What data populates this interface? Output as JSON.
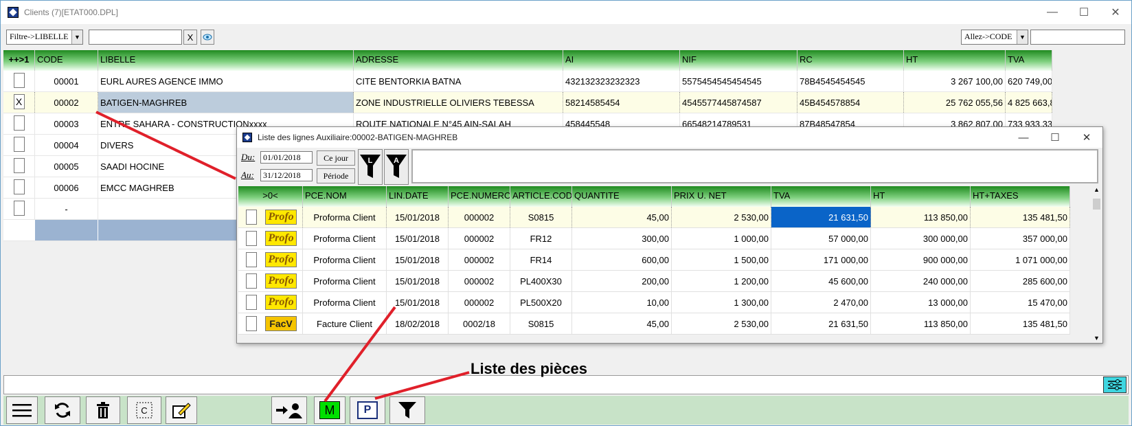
{
  "window": {
    "title": "Clients (7)[ETAT000.DPL]",
    "minimize": "—",
    "maximize": "☐",
    "close": "✕"
  },
  "filterbar": {
    "filter_select": "Filtre->LIBELLE",
    "filter_value": "",
    "clear_label": "X",
    "goto_select": "Allez->CODE",
    "goto_value": ""
  },
  "clients_grid": {
    "headers": [
      "++>1",
      "CODE",
      "LIBELLE",
      "ADRESSE",
      "AI",
      "NIF",
      "RC",
      "HT",
      "TVA"
    ],
    "rows": [
      {
        "check": "",
        "code": "00001",
        "libelle": "EURL AURES AGENCE IMMO",
        "adresse": "CITE BENTORKIA BATNA",
        "ai": "432132323232323",
        "nif": "5575454545454545",
        "rc": "78B4545454545",
        "ht": "3 267 100,00",
        "tva": "620 749,00"
      },
      {
        "check": "X",
        "code": "00002",
        "libelle": "BATIGEN-MAGHREB",
        "adresse": "ZONE INDUSTRIELLE OLIVIERS TEBESSA",
        "ai": "58214585454",
        "nif": "4545577445874587",
        "rc": "45B454578854",
        "ht": "25 762 055,56",
        "tva": "4 825 663,8"
      },
      {
        "check": "",
        "code": "00003",
        "libelle": "ENTRE SAHARA - CONSTRUCTIONxxxx",
        "adresse": "ROUTE NATIONALE N°45 AIN-SALAH",
        "ai": "458445548",
        "nif": "66548214789531",
        "rc": "87B48547854",
        "ht": "3 862 807,00",
        "tva": "733 933,33"
      },
      {
        "check": "",
        "code": "00004",
        "libelle": "DIVERS",
        "adresse": "",
        "ai": "",
        "nif": "",
        "rc": "",
        "ht": "",
        "tva": ""
      },
      {
        "check": "",
        "code": "00005",
        "libelle": "SAADI HOCINE",
        "adresse": "",
        "ai": "",
        "nif": "",
        "rc": "",
        "ht": "",
        "tva": ""
      },
      {
        "check": "",
        "code": "00006",
        "libelle": "EMCC MAGHREB",
        "adresse": "",
        "ai": "",
        "nif": "",
        "rc": "",
        "ht": "",
        "tva": ""
      },
      {
        "check": "",
        "code": "-",
        "libelle": "",
        "adresse": "",
        "ai": "",
        "nif": "",
        "rc": "",
        "ht": "",
        "tva": ""
      }
    ]
  },
  "popup": {
    "title": "Liste des lignes Auxiliaire:00002-BATIGEN-MAGHREB",
    "du_label": "Du:",
    "du_value": "01/01/2018",
    "au_label": "Au:",
    "au_value": "31/12/2018",
    "ce_jour": "Ce jour",
    "periode": "Période",
    "filter_l": "L",
    "filter_a": "A",
    "headers": [
      ">0<",
      "PCE.NOM",
      "LIN.DATE",
      "PCE.NUMERO",
      "ARTICLE.CODE",
      "QUANTITE",
      "PRIX U. NET",
      "TVA",
      "HT",
      "HT+TAXES"
    ],
    "rows": [
      {
        "badge": "Profo",
        "nom": "Proforma Client",
        "date": "15/01/2018",
        "numero": "000002",
        "article": "S0815",
        "qte": "45,00",
        "prix": "2 530,00",
        "tva": "21 631,50",
        "ht": "113 850,00",
        "ttc": "135 481,50"
      },
      {
        "badge": "Profo",
        "nom": "Proforma Client",
        "date": "15/01/2018",
        "numero": "000002",
        "article": "FR12",
        "qte": "300,00",
        "prix": "1 000,00",
        "tva": "57 000,00",
        "ht": "300 000,00",
        "ttc": "357 000,00"
      },
      {
        "badge": "Profo",
        "nom": "Proforma Client",
        "date": "15/01/2018",
        "numero": "000002",
        "article": "FR14",
        "qte": "600,00",
        "prix": "1 500,00",
        "tva": "171 000,00",
        "ht": "900 000,00",
        "ttc": "1 071 000,00"
      },
      {
        "badge": "Profo",
        "nom": "Proforma Client",
        "date": "15/01/2018",
        "numero": "000002",
        "article": "PL400X30",
        "qte": "200,00",
        "prix": "1 200,00",
        "tva": "45 600,00",
        "ht": "240 000,00",
        "ttc": "285 600,00"
      },
      {
        "badge": "Profo",
        "nom": "Proforma Client",
        "date": "15/01/2018",
        "numero": "000002",
        "article": "PL500X20",
        "qte": "10,00",
        "prix": "1 300,00",
        "tva": "2 470,00",
        "ht": "13 000,00",
        "ttc": "15 470,00"
      },
      {
        "badge": "FacV",
        "nom": "Facture Client",
        "date": "18/02/2018",
        "numero": "0002/18",
        "article": "S0815",
        "qte": "45,00",
        "prix": "2 530,00",
        "tva": "21 631,50",
        "ht": "113 850,00",
        "ttc": "135 481,50"
      }
    ]
  },
  "annotation": "Liste des pièces",
  "toolbar": {
    "m_label": "M",
    "p_label": "P",
    "c_label": "C"
  },
  "colors": {
    "header_green": "#1f8a1f",
    "selection_blue": "#0a64c8",
    "toolbar_bg": "#c8e3c8",
    "badge_yellow": "#ffe800",
    "arrow_red": "#e0202a"
  }
}
